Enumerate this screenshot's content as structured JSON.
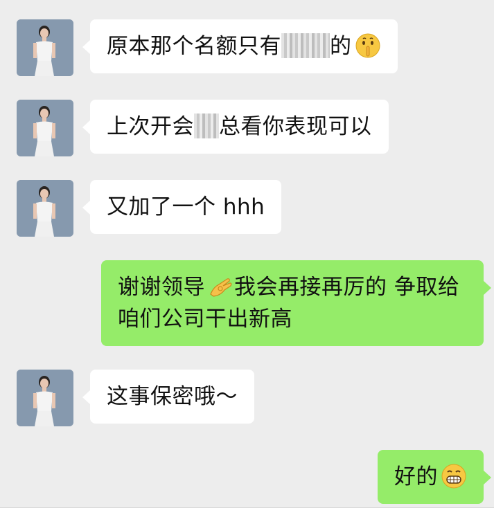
{
  "chat": {
    "messages": [
      {
        "side": "left",
        "text_a": "原本那个名额只有",
        "text_b": "的",
        "emoji": "shushing-face-icon"
      },
      {
        "side": "left",
        "text_a": "上次开会",
        "text_b": "总看你表现可以"
      },
      {
        "side": "left",
        "text": "又加了一个 hhh"
      },
      {
        "side": "right",
        "text_a": "谢谢领导",
        "text_b": "我会再接再厉的 争取给咱们公司干出新高",
        "emoji": "ok-hand-icon"
      },
      {
        "side": "left",
        "text": "这事保密哦～"
      },
      {
        "side": "right",
        "text": "好的",
        "emoji": "grinning-face-icon"
      }
    ]
  },
  "colors": {
    "background": "#ededed",
    "incoming_bubble": "#ffffff",
    "outgoing_bubble": "#95ec69"
  }
}
